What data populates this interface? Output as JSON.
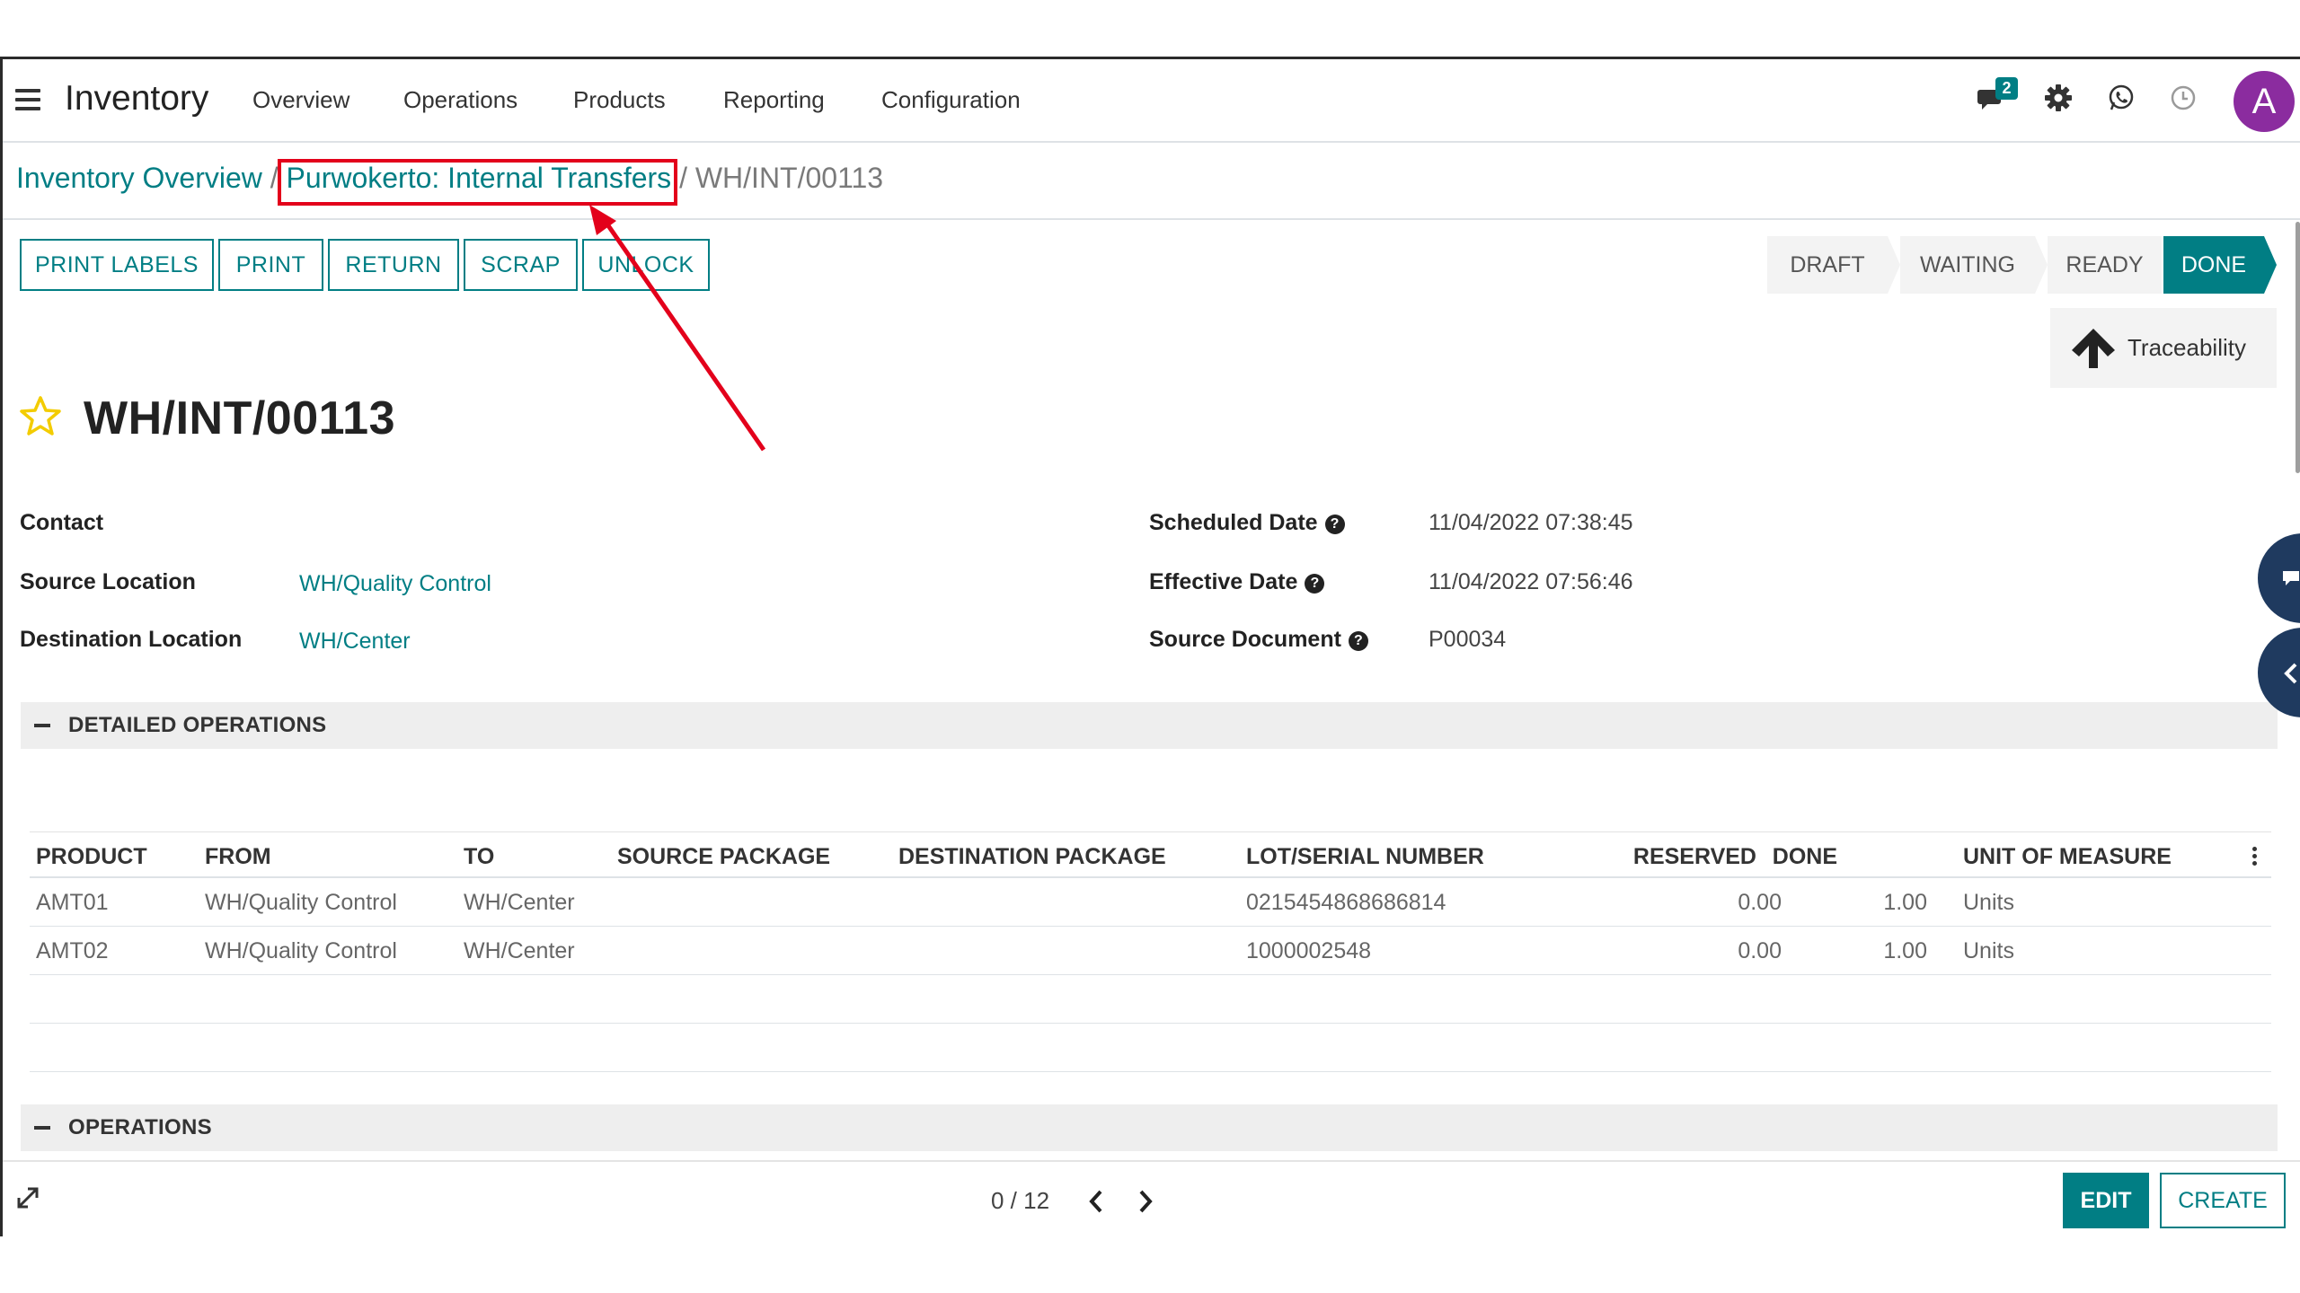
{
  "nav": {
    "app_name": "Inventory",
    "menu": [
      "Overview",
      "Operations",
      "Products",
      "Reporting",
      "Configuration"
    ],
    "message_count": "2",
    "user_initial": "A",
    "icons": [
      "chat-icon",
      "gear-icon",
      "whatsapp-icon",
      "clock-icon"
    ]
  },
  "breadcrumb": {
    "root": "Inventory Overview",
    "parent": "Purwokerto: Internal Transfers",
    "current": "WH/INT/00113",
    "separator": "/"
  },
  "actions": [
    "PRINT LABELS",
    "PRINT",
    "RETURN",
    "SCRAP",
    "UNLOCK"
  ],
  "statusbar": {
    "steps": [
      "DRAFT",
      "WAITING",
      "READY",
      "DONE"
    ],
    "active": "DONE"
  },
  "traceability_label": "Traceability",
  "record": {
    "name": "WH/INT/00113",
    "favorite": false
  },
  "fields": {
    "contact_label": "Contact",
    "contact_value": "",
    "source_location_label": "Source Location",
    "source_location_value": "WH/Quality Control",
    "destination_location_label": "Destination Location",
    "destination_location_value": "WH/Center",
    "scheduled_date_label": "Scheduled Date",
    "scheduled_date_value": "11/04/2022 07:38:45",
    "effective_date_label": "Effective Date",
    "effective_date_value": "11/04/2022 07:56:46",
    "source_document_label": "Source Document",
    "source_document_value": "P00034",
    "help_glyph": "?"
  },
  "sections": {
    "detailed": "DETAILED OPERATIONS",
    "operations": "OPERATIONS"
  },
  "table": {
    "headers": [
      "PRODUCT",
      "FROM",
      "TO",
      "SOURCE PACKAGE",
      "DESTINATION PACKAGE",
      "LOT/SERIAL NUMBER",
      "RESERVED",
      "DONE",
      "UNIT OF MEASURE"
    ],
    "rows": [
      {
        "product": "AMT01",
        "from": "WH/Quality Control",
        "to": "WH/Center",
        "source_package": "",
        "destination_package": "",
        "lot": "0215454868686814",
        "reserved": "0.00",
        "done": "1.00",
        "uom": "Units"
      },
      {
        "product": "AMT02",
        "from": "WH/Quality Control",
        "to": "WH/Center",
        "source_package": "",
        "destination_package": "",
        "lot": "1000002548",
        "reserved": "0.00",
        "done": "1.00",
        "uom": "Units"
      }
    ]
  },
  "footer": {
    "pager": "0 / 12",
    "edit_label": "EDIT",
    "create_label": "CREATE"
  },
  "colors": {
    "accent": "#017e84",
    "avatar": "#8b2c9f",
    "annotation": "#e3001b"
  }
}
